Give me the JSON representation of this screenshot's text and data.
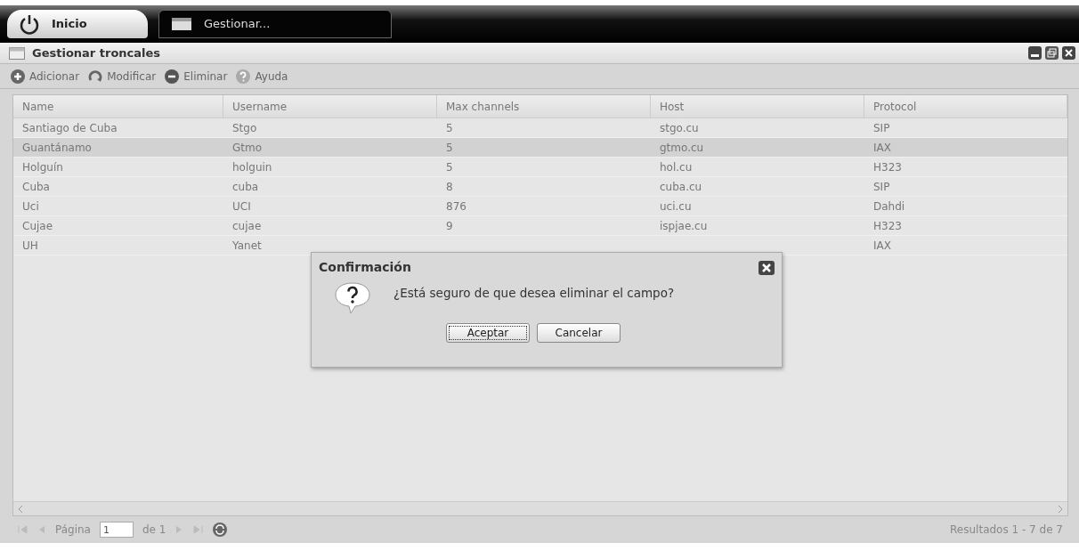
{
  "taskbar": {
    "start_label": "Inicio",
    "tabs": [
      {
        "label": "Gestionar...",
        "selected": true
      }
    ]
  },
  "window": {
    "title": "Gestionar troncales"
  },
  "toolbar": [
    {
      "label": "Adicionar",
      "kind": "add"
    },
    {
      "label": "Modificar",
      "kind": "edit"
    },
    {
      "label": "Eliminar",
      "kind": "delete"
    },
    {
      "label": "Ayuda",
      "kind": "help"
    }
  ],
  "table": {
    "columns": [
      "Name",
      "Username",
      "Max channels",
      "Host",
      "Protocol"
    ],
    "rows": [
      {
        "cells": [
          "Santiago de Cuba",
          "Stgo",
          "5",
          "stgo.cu",
          "SIP"
        ],
        "selected": false
      },
      {
        "cells": [
          "Guantánamo",
          "Gtmo",
          "5",
          "gtmo.cu",
          "IAX"
        ],
        "selected": true
      },
      {
        "cells": [
          "Holguín",
          "holguin",
          "5",
          "hol.cu",
          "H323"
        ],
        "selected": false
      },
      {
        "cells": [
          "Cuba",
          "cuba",
          "8",
          "cuba.cu",
          "SIP"
        ],
        "selected": false
      },
      {
        "cells": [
          "Uci",
          "UCI",
          "876",
          "uci.cu",
          "Dahdi"
        ],
        "selected": false
      },
      {
        "cells": [
          "Cujae",
          "cujae",
          "9",
          "ispjae.cu",
          "H323"
        ],
        "selected": false
      },
      {
        "cells": [
          "UH",
          "Yanet",
          null,
          null,
          "IAX"
        ],
        "selected": false
      }
    ]
  },
  "pager": {
    "page_label": "Página",
    "page": "1",
    "of_label": "de 1",
    "results": "Resultados 1 - 7 de 7"
  },
  "dialog": {
    "title": "Confirmación",
    "message": "¿Está seguro de que desea eliminar el campo?",
    "buttons": [
      {
        "label": "Aceptar",
        "focused": true
      },
      {
        "label": "Cancelar",
        "focused": false
      }
    ]
  }
}
